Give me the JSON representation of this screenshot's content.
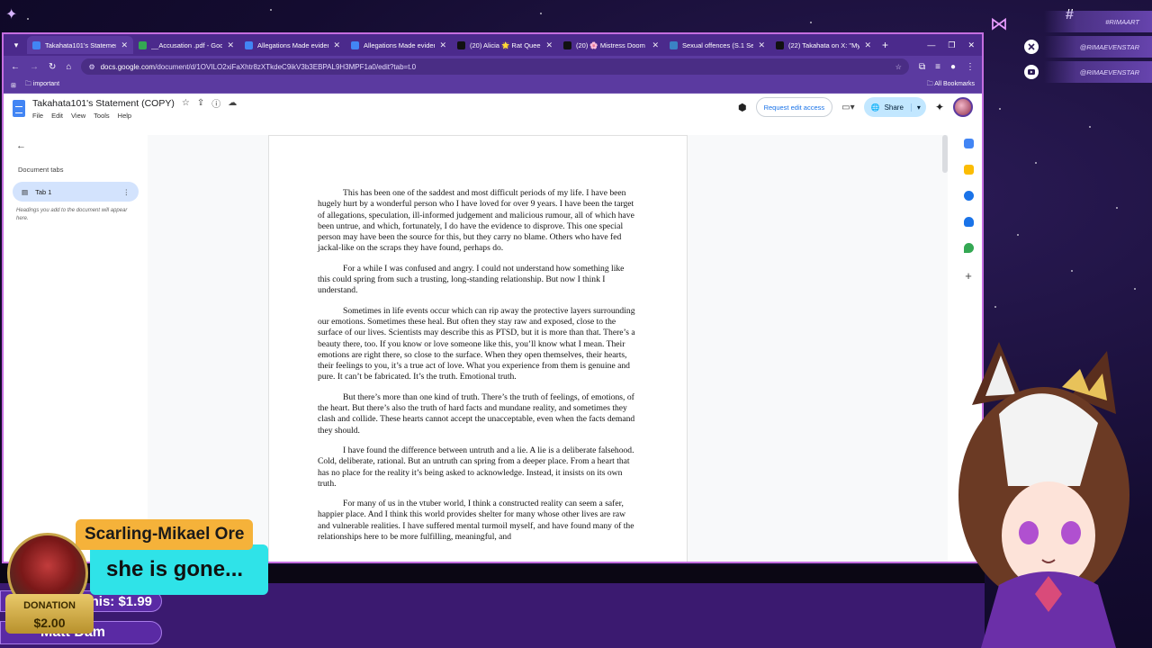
{
  "browser": {
    "tabs": [
      {
        "title": "Takahata101's Statement",
        "color": "#4285f4",
        "active": true
      },
      {
        "title": "__Accusation .pdf - Goo",
        "color": "#34a853",
        "active": false
      },
      {
        "title": "Allegations Made evidenc",
        "color": "#4285f4",
        "active": false
      },
      {
        "title": "Allegations Made eviden",
        "color": "#4285f4",
        "active": false
      },
      {
        "title": "(20) Alicia 🌟 Rat Quee",
        "color": "#111111",
        "active": false
      },
      {
        "title": "(20) 🌸 Mistress Doom 🌸",
        "color": "#111111",
        "active": false
      },
      {
        "title": "Sexual offences (S.1 Sexu",
        "color": "#3b82c4",
        "active": false
      },
      {
        "title": "(22) Takahata on X: \"My T",
        "color": "#111111",
        "active": false
      }
    ],
    "url_host": "docs.google.com",
    "url_path": "/document/d/1OVILO2xiFaXhtr8zXTkdeC9ikV3b3EBPAL9H3MPF1a0/edit?tab=t.0",
    "bookmark_folder": "important",
    "all_bookmarks": "All Bookmarks"
  },
  "docs": {
    "title": "Takahata101's Statement (COPY)",
    "menus": [
      "File",
      "Edit",
      "View",
      "Tools",
      "Help"
    ],
    "request_edit": "Request edit access",
    "share": "Share",
    "document_tabs_label": "Document tabs",
    "tab1": "Tab 1",
    "hint": "Headings you add to the document will appear here.",
    "paragraphs": [
      "This has been one of the saddest and most difficult periods of my life. I have been hugely hurt by a wonderful person who I have loved for over 9 years. I have been the target of allegations, speculation, ill-informed judgement and malicious rumour, all of which have been untrue, and which, fortunately, I do have the evidence to disprove. This one special person may have been the source for this, but they carry no blame. Others who have fed jackal-like on the scraps they have found, perhaps do.",
      "For a while I was confused and angry. I could not understand how something like this could spring from such a trusting, long-standing relationship. But now I think I understand.",
      "Sometimes in life events occur which can rip away the protective layers surrounding our emotions. Sometimes these heal. But often they stay raw and exposed, close to the surface of our lives. Scientists may describe this as PTSD, but it is more than that. There’s a beauty there, too. If you know or love someone like this, you’ll know what I mean. Their emotions are right there, so close to the surface. When they open themselves, their hearts, their feelings to you, it’s a true act of love. What you experience from them is genuine and pure. It can’t be fabricated. It’s the truth. Emotional truth.",
      "But there’s more than one kind of truth. There’s the truth of feelings, of emotions, of the heart. But there’s also the truth of hard facts and mundane reality, and sometimes they clash and collide. These hearts cannot accept the unacceptable, even when the facts demand they should.",
      "I have found the difference between untruth and a lie. A lie is a deliberate falsehood. Cold, deliberate, rational. But an untruth can spring from a deeper place. From a heart that has no place for the reality it’s being asked to acknowledge. Instead, it insists on its own truth.",
      "For many of us in the vtuber world, I think a constructed reality can seem a safer, happier place. And I think this world provides shelter for many whose other lives are raw and vulnerable realities. I have suffered mental turmoil myself, and have found many of the relationships here to be more fulfilling, meaningful, and"
    ]
  },
  "overlay": {
    "social": [
      "#RIMAART",
      "@RIMAEVENSTAR",
      "@RIMAEVENSTAR"
    ],
    "donor_name": "Scarling-Mikael Ore",
    "donor_message": "she is gone...",
    "donation_label": "DONATION",
    "donation_amount": "$2.00",
    "ticker_1": "Draconis: $1.99",
    "ticker_2": "Matt Dam"
  }
}
